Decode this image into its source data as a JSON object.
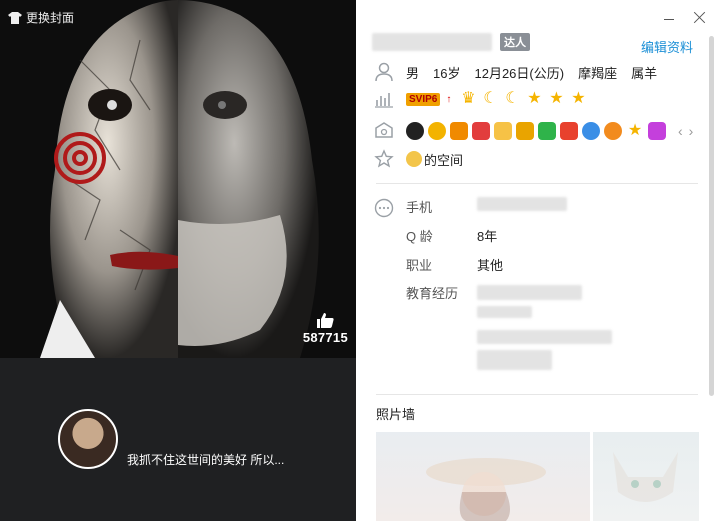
{
  "cover": {
    "change_label": "更换封面",
    "like_count": "587715"
  },
  "profile": {
    "signature": "我抓不住这世间的美好 所以...",
    "daren_badge": "达人",
    "edit_label": "编辑资料",
    "gender": "男",
    "age": "16岁",
    "birthday": "12月26日(公历)",
    "constellation": "摩羯座",
    "zodiac": "属羊",
    "svip_label": "SVIP6",
    "space_label": "的空间"
  },
  "details": {
    "phone_label": "手机",
    "qage_label": "Q 龄",
    "qage_value": "8年",
    "job_label": "职业",
    "job_value": "其他",
    "edu_label": "教育经历"
  },
  "photo_wall": {
    "title": "照片墙"
  },
  "colors": {
    "accent": "#1b8fd6",
    "left_bg": "#1f2022",
    "star": "#f5b400"
  },
  "icons": {
    "change_cover": "tshirt-icon",
    "like": "thumbs-up-icon",
    "person": "person-icon",
    "level": "level-chart-icon",
    "medal": "medal-icon",
    "space": "star-outline-icon",
    "more": "more-circle-icon",
    "minimize": "minimize-icon",
    "close": "close-icon"
  }
}
